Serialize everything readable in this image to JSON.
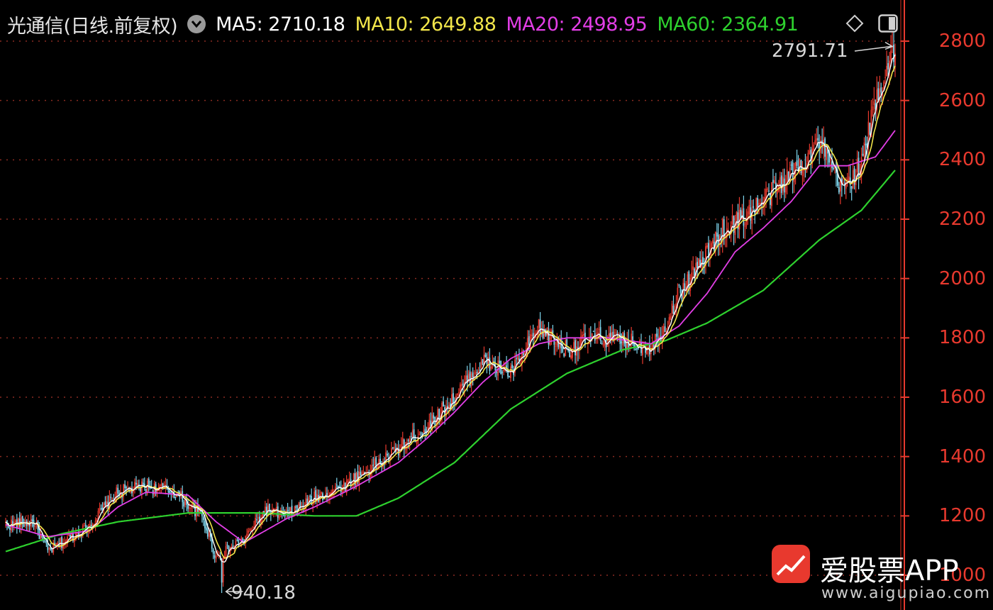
{
  "header": {
    "title": "光通信(日线.前复权)",
    "ma5": "MA5: 2710.18",
    "ma10": "MA10: 2649.88",
    "ma20": "MA20: 2498.95",
    "ma60": "MA60: 2364.91"
  },
  "icons": {
    "dropdown": "chevron-down-icon",
    "draw": "diamond-icon",
    "panel": "panel-toggle-icon"
  },
  "colors": {
    "background": "#000000",
    "up": "#e8392e",
    "down": "#7fd6ee",
    "axis": "#e8392e",
    "grid": "#8a2b22",
    "ma5": "#ffffff",
    "ma10": "#f2e64a",
    "ma20": "#e23ee6",
    "ma60": "#2ed12e"
  },
  "annotations": {
    "high_label": "2791.71",
    "low_label": "940.18"
  },
  "watermark": {
    "brand": "爱股票APP",
    "url": "www.aigupiao.com"
  },
  "chart_data": {
    "type": "candlestick",
    "ylim": [
      935,
      2830
    ],
    "yticks": [
      1000,
      1200,
      1400,
      1600,
      1800,
      2000,
      2200,
      2400,
      2600,
      2800
    ],
    "grid": true,
    "close_anchors": [
      [
        0,
        1170
      ],
      [
        20,
        1180
      ],
      [
        30,
        1080
      ],
      [
        60,
        1170
      ],
      [
        80,
        1280
      ],
      [
        100,
        1300
      ],
      [
        120,
        1280
      ],
      [
        140,
        1200
      ],
      [
        150,
        1060
      ],
      [
        170,
        1120
      ],
      [
        185,
        1220
      ],
      [
        200,
        1200
      ],
      [
        220,
        1260
      ],
      [
        240,
        1300
      ],
      [
        270,
        1390
      ],
      [
        300,
        1500
      ],
      [
        320,
        1600
      ],
      [
        340,
        1720
      ],
      [
        360,
        1680
      ],
      [
        380,
        1830
      ],
      [
        400,
        1760
      ],
      [
        420,
        1800
      ],
      [
        440,
        1790
      ],
      [
        460,
        1770
      ],
      [
        470,
        1840
      ],
      [
        480,
        1950
      ],
      [
        500,
        2080
      ],
      [
        510,
        2160
      ],
      [
        530,
        2220
      ],
      [
        560,
        2350
      ],
      [
        580,
        2460
      ],
      [
        595,
        2300
      ],
      [
        610,
        2380
      ],
      [
        620,
        2600
      ],
      [
        634,
        2790
      ]
    ],
    "ma20_anchors": [
      [
        0,
        1170
      ],
      [
        30,
        1130
      ],
      [
        60,
        1150
      ],
      [
        80,
        1230
      ],
      [
        100,
        1280
      ],
      [
        130,
        1270
      ],
      [
        150,
        1180
      ],
      [
        170,
        1110
      ],
      [
        200,
        1190
      ],
      [
        220,
        1230
      ],
      [
        250,
        1300
      ],
      [
        280,
        1380
      ],
      [
        300,
        1460
      ],
      [
        320,
        1550
      ],
      [
        340,
        1650
      ],
      [
        360,
        1730
      ],
      [
        380,
        1780
      ],
      [
        400,
        1800
      ],
      [
        430,
        1800
      ],
      [
        460,
        1780
      ],
      [
        480,
        1840
      ],
      [
        500,
        1950
      ],
      [
        520,
        2090
      ],
      [
        540,
        2170
      ],
      [
        560,
        2260
      ],
      [
        580,
        2380
      ],
      [
        600,
        2380
      ],
      [
        620,
        2410
      ],
      [
        634,
        2499
      ]
    ],
    "ma60_anchors": [
      [
        0,
        1080
      ],
      [
        40,
        1140
      ],
      [
        80,
        1180
      ],
      [
        130,
        1210
      ],
      [
        180,
        1210
      ],
      [
        220,
        1200
      ],
      [
        250,
        1200
      ],
      [
        280,
        1260
      ],
      [
        320,
        1380
      ],
      [
        360,
        1560
      ],
      [
        400,
        1680
      ],
      [
        440,
        1760
      ],
      [
        470,
        1790
      ],
      [
        500,
        1850
      ],
      [
        540,
        1960
      ],
      [
        580,
        2130
      ],
      [
        610,
        2230
      ],
      [
        634,
        2365
      ]
    ],
    "high": 2791.71,
    "low": 940.18
  }
}
